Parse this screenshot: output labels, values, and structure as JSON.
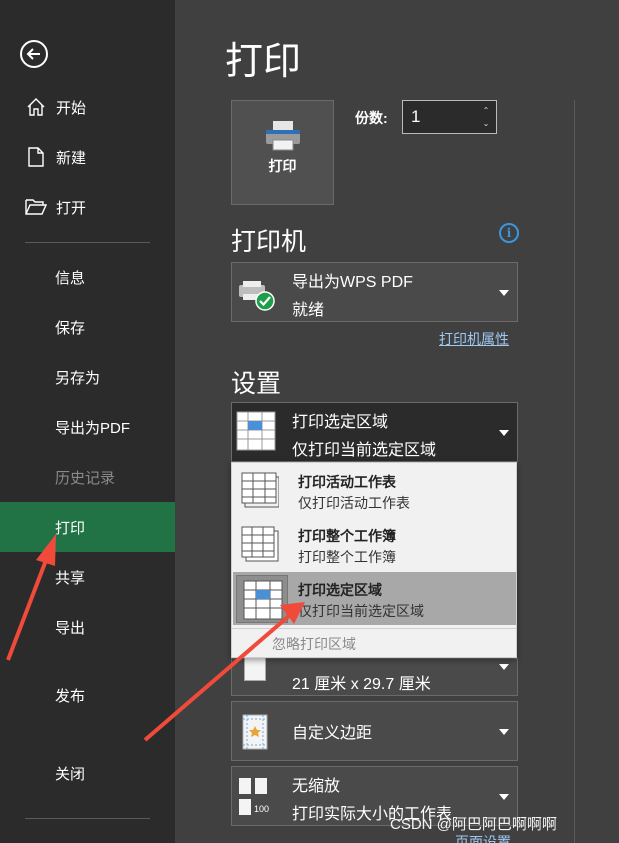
{
  "sidebar": {
    "items": [
      {
        "label": "开始"
      },
      {
        "label": "新建"
      },
      {
        "label": "打开"
      },
      {
        "label": "信息"
      },
      {
        "label": "保存"
      },
      {
        "label": "另存为"
      },
      {
        "label": "导出为PDF"
      },
      {
        "label": "历史记录"
      },
      {
        "label": "打印"
      },
      {
        "label": "共享"
      },
      {
        "label": "导出"
      },
      {
        "label": "发布"
      },
      {
        "label": "关闭"
      }
    ]
  },
  "main": {
    "title": "打印",
    "print_button_label": "打印",
    "copies_label": "份数:",
    "copies_value": "1",
    "printer_heading": "打印机",
    "printer": {
      "name": "导出为WPS PDF",
      "status": "就绪"
    },
    "printer_props_link": "打印机属性",
    "settings_heading": "设置",
    "print_range": {
      "title": "打印选定区域",
      "subtitle": "仅打印当前选定区域"
    },
    "menu": {
      "items": [
        {
          "title": "打印活动工作表",
          "subtitle": "仅打印活动工作表"
        },
        {
          "title": "打印整个工作簿",
          "subtitle": "打印整个工作簿"
        },
        {
          "title": "打印选定区域",
          "subtitle": "仅打印当前选定区域"
        }
      ],
      "ignore_label": "忽略打印区域"
    },
    "paper_size": "21 厘米 x 29.7 厘米",
    "margins": "自定义边距",
    "scaling": {
      "title": "无缩放",
      "subtitle": "打印实际大小的工作表",
      "icon_text": "100"
    },
    "page_setup_link": "页面设置"
  },
  "watermark": "CSDN @阿巴阿巴啊啊啊",
  "colors": {
    "active": "#217346",
    "link": "#9fc8f0",
    "info": "#3a96dd",
    "annotation": "#f04a3a"
  }
}
